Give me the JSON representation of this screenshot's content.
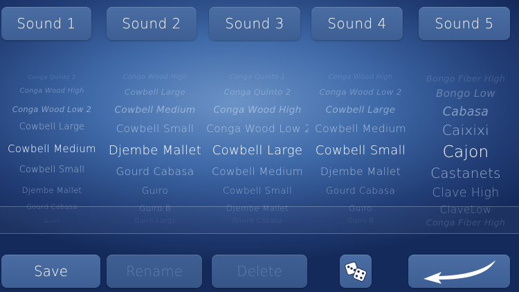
{
  "tabs": [
    "Sound 1",
    "Sound 2",
    "Sound 3",
    "Sound 4",
    "Sound 5"
  ],
  "picker_columns": [
    [
      "Conga Quinto 2",
      "Conga Wood High",
      "Conga Wood Low 2",
      "Cowbell Large",
      "Cowbell Medium",
      "Cowbell Small",
      "Djembe Mallet",
      "Gourd Cabasa",
      "Guiro"
    ],
    [
      "Conga Wood High",
      "Cowbell Large",
      "Cowbell Medium",
      "Cowbell Small",
      "Djembe Mallet",
      "Gourd Cabasa",
      "Guiro",
      "Guiro B",
      "Guiro Large"
    ],
    [
      "Conga Quinto 1",
      "Conga Quinto 2",
      "Conga Wood High",
      "Conga Wood Low 2",
      "Cowbell Large",
      "Cowbell Medium",
      "Cowbell Small",
      "Djembe Mallet",
      "Gourd Cabasa"
    ],
    [
      "Conga Wood High",
      "Conga Wood Low 2",
      "Cowbell Large",
      "Cowbell Medium",
      "Cowbell Small",
      "Djembe Mallet",
      "Gourd Cabasa",
      "Guiro",
      "Guiro B"
    ],
    [
      "Bongo Fiber High",
      "Bongo Low",
      "Cabasa",
      "Caixixi",
      "Cajon",
      "Castanets",
      "Clave High",
      "ClaveLow",
      "Conga Fiber High"
    ]
  ],
  "selected_index": 4,
  "bottom": {
    "save": "Save",
    "rename": "Rename",
    "delete": "Delete"
  }
}
